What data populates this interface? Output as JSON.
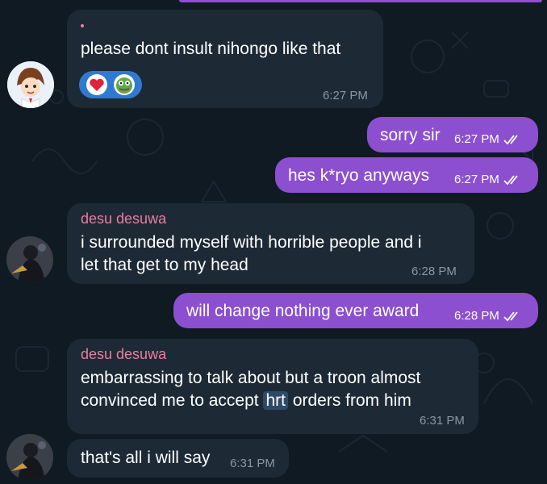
{
  "messages": [
    {
      "id": "m1",
      "dir": "in",
      "sender": "",
      "text": "please dont insult nihongo like that",
      "time": "6:27 PM",
      "reactions": [
        "red-heart-icon",
        "pepe-frog-icon"
      ]
    },
    {
      "id": "m2",
      "dir": "out",
      "text": "sorry sir",
      "time": "6:27 PM",
      "status": "read"
    },
    {
      "id": "m3",
      "dir": "out",
      "text": "hes k*ryo anyways",
      "time": "6:27 PM",
      "status": "read"
    },
    {
      "id": "m4",
      "dir": "in",
      "sender": "desu desuwa",
      "lines": [
        "i surrounded myself with horrible people and i",
        "let that get to my head"
      ],
      "time": "6:28 PM"
    },
    {
      "id": "m5",
      "dir": "out",
      "text": "will change nothing ever award",
      "time": "6:28 PM",
      "status": "read"
    },
    {
      "id": "m6",
      "dir": "in",
      "sender": "desu desuwa",
      "line1": "embarrassing to talk about but a troon almost",
      "line2_before": "convinced me to accept ",
      "line2_highlight": "hrt",
      "line2_after": " orders from him",
      "time": "6:31 PM"
    },
    {
      "id": "m7",
      "dir": "in",
      "sender": "",
      "text": "that's all i will say",
      "time": "6:31 PM"
    }
  ],
  "colors": {
    "background": "#0f1a23",
    "incoming_bubble": "#1d2a36",
    "outgoing_bubble": "#8b4fcf",
    "sender_name": "#ec7da0",
    "incoming_time": "#8b96a1"
  }
}
